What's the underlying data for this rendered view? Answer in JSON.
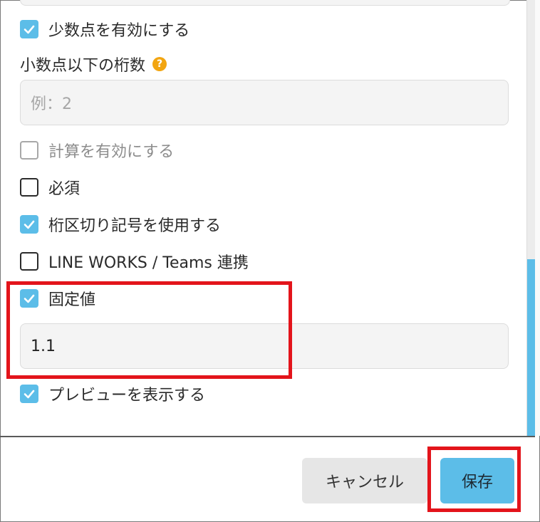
{
  "settings": {
    "decimal_enabled_label": "少数点を有効にする",
    "decimal_places_label": "小数点以下の桁数",
    "decimal_places_help": "?",
    "decimal_places_placeholder": "例：2",
    "calculation_label": "計算を有効にする",
    "required_label": "必須",
    "thousands_separator_label": "桁区切り記号を使用する",
    "lineworks_teams_label": "LINE WORKS / Teams 連携",
    "fixed_value_label": "固定値",
    "fixed_value": "1.1",
    "preview_label": "プレビューを表示する"
  },
  "checkbox_states": {
    "decimal_enabled": "checked",
    "calculation": "unchecked-disabled",
    "required": "unchecked",
    "thousands_separator": "checked",
    "lineworks_teams": "unchecked",
    "fixed_value": "checked",
    "preview": "checked"
  },
  "footer": {
    "cancel_label": "キャンセル",
    "save_label": "保存"
  },
  "colors": {
    "accent": "#5cbde8",
    "highlight": "#e3141b",
    "help_icon": "#f2a511"
  }
}
